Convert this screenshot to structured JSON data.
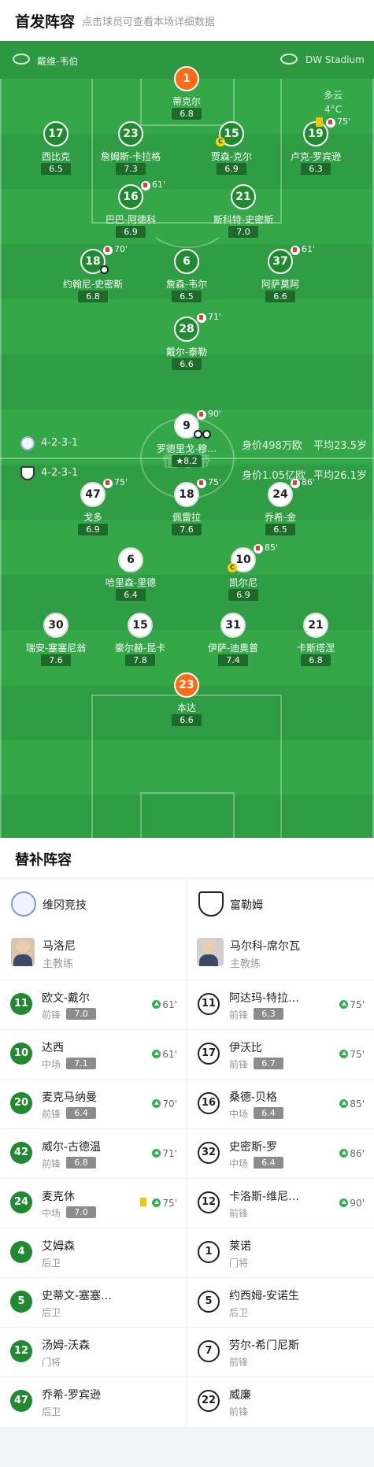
{
  "header": {
    "title": "首发阵容",
    "subtitle": "点击球员可查看本场详细数据"
  },
  "pitch": {
    "home_team": "戴维-韦伯",
    "venue": "DW Stadium",
    "weather": {
      "condition": "多云",
      "temp": "4°C"
    },
    "watermark": "懂球帝",
    "home_summary": {
      "formation": "4-2-3-1",
      "value": "身价498万欧",
      "age": "平均23.5岁"
    },
    "away_summary": {
      "formation": "4-2-3-1",
      "value": "身价1.05亿欧",
      "age": "平均26.1岁"
    },
    "home_players": [
      {
        "num": "1",
        "name": "蒂克尔",
        "rating": "6.8",
        "gk": true
      },
      {
        "num": "17",
        "name": "西比克",
        "rating": "6.5"
      },
      {
        "num": "23",
        "name": "詹姆斯-卡拉格",
        "rating": "7.3"
      },
      {
        "num": "15",
        "name": "贾森-克尔",
        "rating": "6.9",
        "captain": "C"
      },
      {
        "num": "19",
        "name": "卢克-罗宾逊",
        "rating": "6.3",
        "sub_time": "75'",
        "card": true
      },
      {
        "num": "16",
        "name": "巴巴-阿德科",
        "rating": "6.9",
        "sub_time": "61'"
      },
      {
        "num": "21",
        "name": "斯科特-史密斯",
        "rating": "7.0"
      },
      {
        "num": "18",
        "name": "约翰尼-史密斯",
        "rating": "6.8",
        "sub_time": "70'",
        "goal": true
      },
      {
        "num": "6",
        "name": "詹森-韦尔",
        "rating": "6.5"
      },
      {
        "num": "37",
        "name": "阿萨莫阿",
        "rating": "6.6",
        "sub_time": "61'"
      },
      {
        "num": "28",
        "name": "戴尔-泰勒",
        "rating": "6.6",
        "sub_time": "71'"
      }
    ],
    "away_players": [
      {
        "num": "9",
        "name": "罗德里戈-穆…",
        "rating": "8.2",
        "sub_time": "90'",
        "star": true,
        "goals": 2
      },
      {
        "num": "47",
        "name": "戈多",
        "rating": "6.9",
        "sub_time": "75'"
      },
      {
        "num": "18",
        "name": "佩雷拉",
        "rating": "7.6",
        "sub_time": "75'"
      },
      {
        "num": "24",
        "name": "乔希-金",
        "rating": "6.5",
        "sub_time": "86'"
      },
      {
        "num": "6",
        "name": "哈里森-里德",
        "rating": "6.4"
      },
      {
        "num": "10",
        "name": "凯尔尼",
        "rating": "6.9",
        "sub_time": "85'",
        "captain": "C"
      },
      {
        "num": "30",
        "name": "瑞安-塞塞尼翁",
        "rating": "7.6"
      },
      {
        "num": "15",
        "name": "豪尔赫-昆卡",
        "rating": "7.8"
      },
      {
        "num": "31",
        "name": "伊萨-迪奥普",
        "rating": "7.4"
      },
      {
        "num": "21",
        "name": "卡斯塔涅",
        "rating": "6.8"
      },
      {
        "num": "23",
        "name": "本达",
        "rating": "6.6",
        "gk": true
      }
    ]
  },
  "subs": {
    "title": "替补阵容",
    "home": {
      "team": "维冈竞技",
      "coach": {
        "name": "马洛尼",
        "role": "主教练"
      },
      "players": [
        {
          "num": "11",
          "name": "欧文-戴尔",
          "pos": "前锋",
          "rating": "7.0",
          "in": "61'"
        },
        {
          "num": "10",
          "name": "达西",
          "pos": "中场",
          "rating": "7.1",
          "in": "61'"
        },
        {
          "num": "20",
          "name": "麦克马纳曼",
          "pos": "前锋",
          "rating": "6.4",
          "in": "70'"
        },
        {
          "num": "42",
          "name": "威尔-古德温",
          "pos": "前锋",
          "rating": "6.8",
          "in": "71'"
        },
        {
          "num": "24",
          "name": "麦克休",
          "pos": "中场",
          "rating": "7.0",
          "in": "75'",
          "card": true
        },
        {
          "num": "4",
          "name": "艾姆森",
          "pos": "后卫"
        },
        {
          "num": "5",
          "name": "史蒂文-塞塞…",
          "pos": "后卫"
        },
        {
          "num": "12",
          "name": "汤姆-沃森",
          "pos": "门将"
        },
        {
          "num": "47",
          "name": "乔希-罗宾逊",
          "pos": "后卫"
        }
      ]
    },
    "away": {
      "team": "富勒姆",
      "coach": {
        "name": "马尔科-席尔瓦",
        "role": "主教练"
      },
      "players": [
        {
          "num": "11",
          "name": "阿达玛-特拉…",
          "pos": "前锋",
          "rating": "6.3",
          "in": "75'"
        },
        {
          "num": "17",
          "name": "伊沃比",
          "pos": "前锋",
          "rating": "6.7",
          "in": "75'"
        },
        {
          "num": "16",
          "name": "桑德-贝格",
          "pos": "中场",
          "rating": "6.4",
          "in": "85'"
        },
        {
          "num": "32",
          "name": "史密斯-罗",
          "pos": "中场",
          "rating": "6.4",
          "in": "86'"
        },
        {
          "num": "12",
          "name": "卡洛斯-维尼…",
          "pos": "前锋",
          "in": "90'"
        },
        {
          "num": "1",
          "name": "莱诺",
          "pos": "门将"
        },
        {
          "num": "5",
          "name": "约西姆-安诺生",
          "pos": "后卫"
        },
        {
          "num": "7",
          "name": "劳尔-希门尼斯",
          "pos": "前锋"
        },
        {
          "num": "22",
          "name": "威廉",
          "pos": "前锋"
        }
      ]
    }
  }
}
